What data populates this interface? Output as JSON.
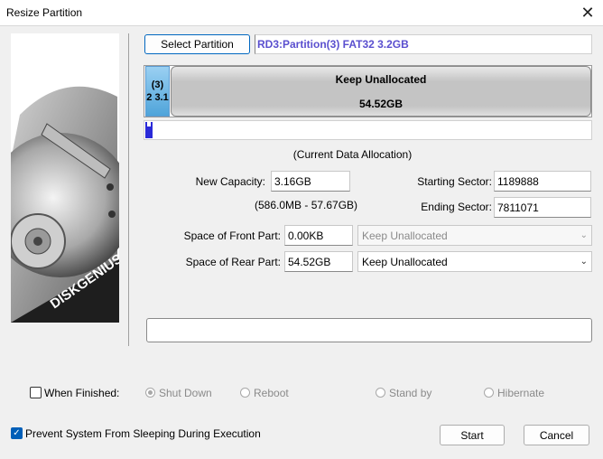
{
  "window": {
    "title": "Resize Partition"
  },
  "header": {
    "select_partition_label": "Select Partition",
    "partition_info": "RD3:Partition(3) FAT32 3.2GB"
  },
  "map": {
    "part_label_1": "(3)",
    "part_label_2": "2 3.1",
    "unalloc_label": "Keep Unallocated",
    "unalloc_size": "54.52GB",
    "caption": "(Current Data Allocation)"
  },
  "form": {
    "new_capacity_label": "New Capacity:",
    "new_capacity_value": "3.16GB",
    "range_text": "(586.0MB - 57.67GB)",
    "starting_sector_label": "Starting Sector:",
    "starting_sector_value": "1189888",
    "ending_sector_label": "Ending Sector:",
    "ending_sector_value": "7811071",
    "front_label": "Space of Front Part:",
    "front_value": "0.00KB",
    "front_option": "Keep Unallocated",
    "rear_label": "Space of Rear Part:",
    "rear_value": "54.52GB",
    "rear_option": "Keep Unallocated"
  },
  "progress": {
    "value": 0
  },
  "finish": {
    "when_finished_label": "When Finished:",
    "when_finished_checked": false,
    "options": [
      "Shut Down",
      "Reboot",
      "Stand by",
      "Hibernate"
    ],
    "selected": "Shut Down"
  },
  "prevent_sleep": {
    "label": "Prevent System From Sleeping During Execution",
    "checked": true
  },
  "actions": {
    "start_label": "Start",
    "cancel_label": "Cancel"
  },
  "side_image": {
    "brand": "DISKGENIUS"
  },
  "colors": {
    "accent": "#0067c0",
    "partition_blue": "#6cb8e6",
    "unalloc": "#c8c8c8",
    "info_text": "#5a4fcf"
  }
}
